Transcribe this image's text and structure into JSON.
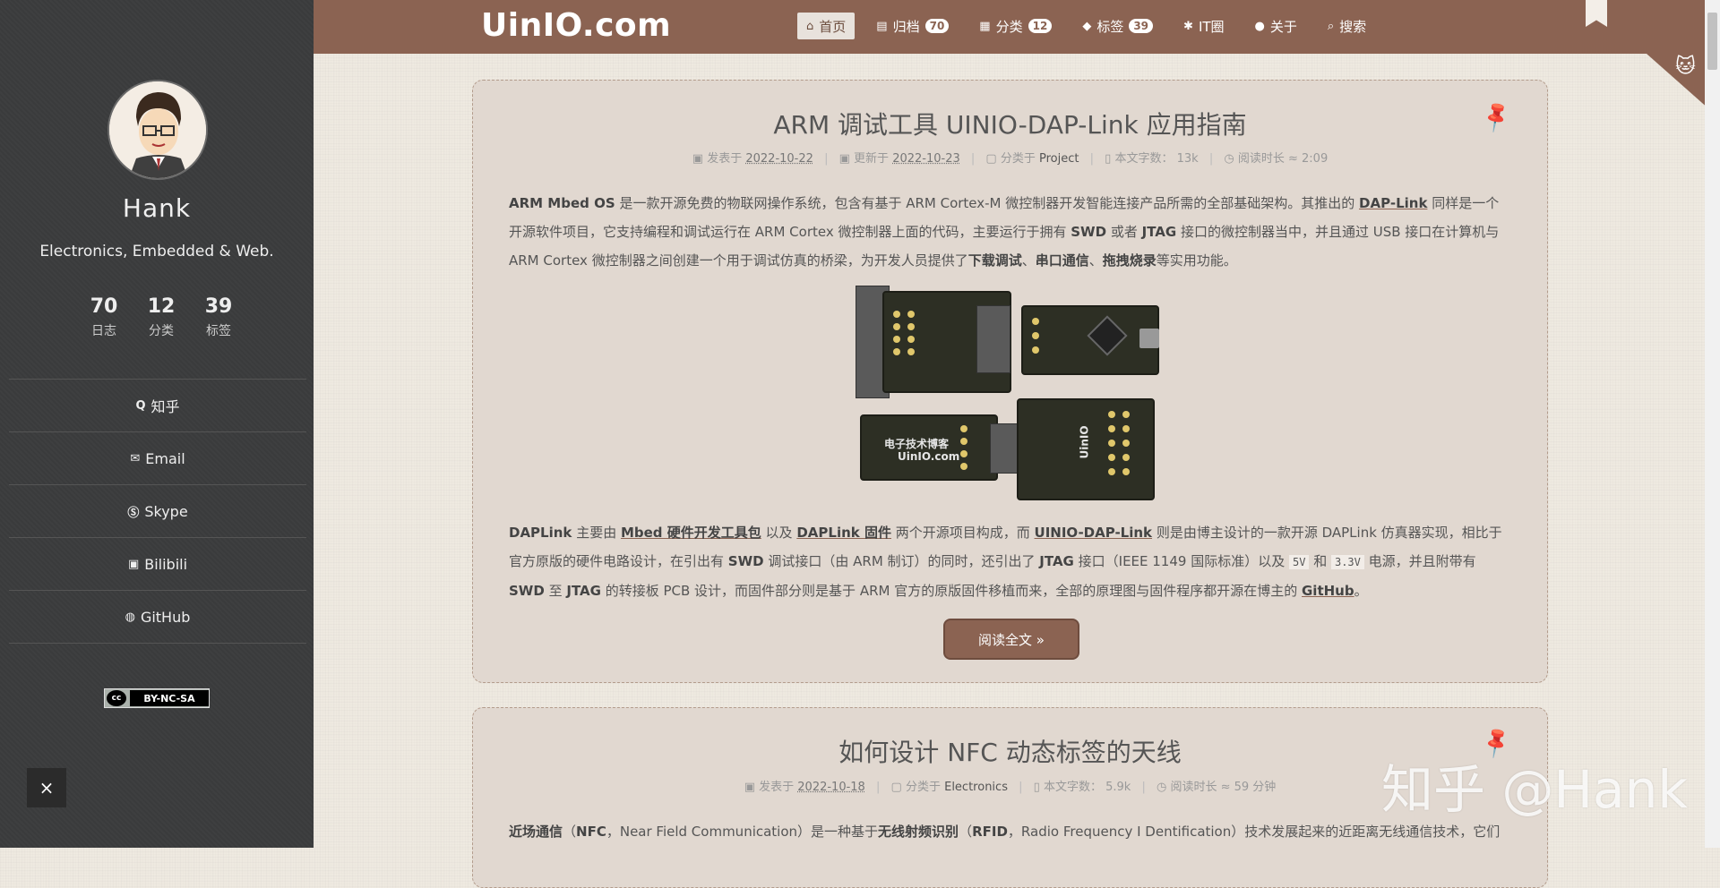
{
  "sidebar": {
    "author_name": "Hank",
    "author_desc": "Electronics, Embedded & Web.",
    "stats": [
      {
        "num": "70",
        "label": "日志"
      },
      {
        "num": "12",
        "label": "分类"
      },
      {
        "num": "39",
        "label": "标签"
      }
    ],
    "links": [
      {
        "icon": "Q",
        "label": "知乎"
      },
      {
        "icon": "✉",
        "label": "Email"
      },
      {
        "icon": "Ⓢ",
        "label": "Skype"
      },
      {
        "icon": "▣",
        "label": "Bilibili"
      },
      {
        "icon": "◍",
        "label": "GitHub"
      }
    ],
    "license": "BY-NC-SA",
    "close": "×"
  },
  "header": {
    "logo": "UinIO.com",
    "nav": [
      {
        "icon": "⌂",
        "label": "首页"
      },
      {
        "icon": "▤",
        "label": "归档",
        "badge": "70"
      },
      {
        "icon": "▦",
        "label": "分类",
        "badge": "12"
      },
      {
        "icon": "◆",
        "label": "标签",
        "badge": "39"
      },
      {
        "icon": "✱",
        "label": "IT圈"
      },
      {
        "icon": "●",
        "label": "关于"
      },
      {
        "icon": "⌕",
        "label": "搜索"
      }
    ]
  },
  "post1": {
    "title": "ARM 调试工具 UINIO-DAP-Link 应用指南",
    "meta_published_label": "发表于",
    "meta_published": "2022-10-22",
    "meta_updated_label": "更新于",
    "meta_updated": "2022-10-23",
    "meta_category_label": "分类于",
    "meta_category": "Project",
    "meta_words_label": "本文字数：",
    "meta_words": "13k",
    "meta_time_label": "阅读时长 ≈",
    "meta_time": "2:09",
    "para1": {
      "t1": "ARM Mbed OS",
      "t2": " 是一款开源免费的物联网操作系统，包含有基于 ARM Cortex-M 微控制器开发智能连接产品所需的全部基础架构。其推出的 ",
      "t3": "DAP-Link",
      "t4": " 同样是一个开源软件项目，它支持编程和调试运行在 ARM Cortex 微控制器上面的代码，主要运行于拥有 ",
      "t5": "SWD",
      "t6": " 或者 ",
      "t7": "JTAG",
      "t8": " 接口的微控制器当中，并且通过 USB 接口在计算机与 ARM Cortex 微控制器之间创建一个用于调试仿真的桥梁，为开发人员提供了",
      "t9": "下载调试",
      "t10": "、",
      "t11": "串口通信",
      "t12": "、",
      "t13": "拖拽烧录",
      "t14": "等实用功能。"
    },
    "para2": {
      "t1": "DAPLink",
      "t2": " 主要由 ",
      "t3": "Mbed 硬件开发工具包",
      "t4": " 以及 ",
      "t5": "DAPLink 固件",
      "t6": " 两个开源项目构成，而 ",
      "t7": "UINIO-DAP-Link",
      "t8": " 则是由博主设计的一款开源 DAPLink 仿真器实现，相比于官方原版的硬件电路设计，在引出有 ",
      "t9": "SWD",
      "t10": " 调试接口（由 ARM 制订）的同时，还引出了 ",
      "t11": "JTAG",
      "t12": " 接口（IEEE 1149 国际标准）以及 ",
      "t13": "5V",
      "t14": " 和 ",
      "t15": "3.3V",
      "t16": " 电源，并且附带有 ",
      "t17": "SWD",
      "t18": " 至 ",
      "t19": "JTAG",
      "t20": " 的转接板 PCB 设计，而固件部分则是基于 ARM 官方的原版固件移植而来，全部的原理图与固件程序都开源在博主的 ",
      "t21": "GitHub",
      "t22": "。"
    },
    "pcb_label1": "电子技术博客",
    "pcb_label2": "UinIO.com",
    "read_more": "阅读全文 »"
  },
  "post2": {
    "title": "如何设计 NFC 动态标签的天线",
    "meta_published_label": "发表于",
    "meta_published": "2022-10-18",
    "meta_category_label": "分类于",
    "meta_category": "Electronics",
    "meta_words_label": "本文字数：",
    "meta_words": "5.9k",
    "meta_time_label": "阅读时长 ≈",
    "meta_time": "59 分钟",
    "para": {
      "t1": "近场通信",
      "t2": "（",
      "t3": "NFC",
      "t4": "，Near Field Communication）是一种基于",
      "t5": "无线射频识别",
      "t6": "（",
      "t7": "RFID",
      "t8": "，Radio Frequency I Dentification）技术发展起来的近距离无线通信技术，它们"
    }
  },
  "watermark": "知乎 @Hank"
}
